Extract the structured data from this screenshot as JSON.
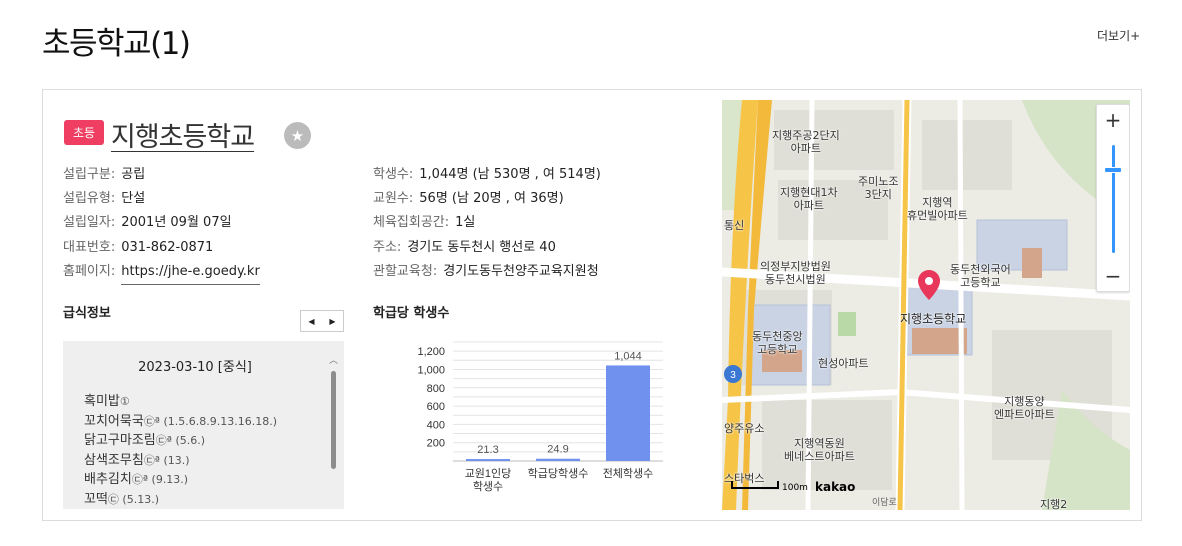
{
  "header": {
    "title": "초등학교(1)",
    "more_label": "더보기+"
  },
  "school": {
    "badge": "초등",
    "name": "지행초등학교",
    "fav_icon": "star-icon",
    "left_info": [
      {
        "label": "설립구분",
        "value": "공립"
      },
      {
        "label": "설립유형",
        "value": "단설"
      },
      {
        "label": "설립일자",
        "value": "2001년 09월 07일"
      },
      {
        "label": "대표번호",
        "value": "031-862-0871"
      },
      {
        "label": "홈페이지",
        "value": "https://jhe-e.goedy.kr"
      }
    ],
    "right_info": [
      {
        "label": "학생수",
        "value": "1,044명 (남 530명 , 여 514명)"
      },
      {
        "label": "교원수",
        "value": "56명 (남 20명 , 여 36명)"
      },
      {
        "label": "체육집회공간",
        "value": "1실"
      },
      {
        "label": "주소",
        "value": "경기도 동두천시 행선로 40"
      },
      {
        "label": "관할교육청",
        "value": "경기도동두천양주교육지원청"
      }
    ]
  },
  "meal": {
    "title": "급식정보",
    "prev_icon": "triangle-left-icon",
    "next_icon": "triangle-right-icon",
    "date": "2023-03-10 [중식]",
    "items": [
      {
        "name": "혹미밥",
        "allergy": "①"
      },
      {
        "name": "꼬치어묵국",
        "allergy": "㉢ª (1.5.6.8.9.13.16.18.)"
      },
      {
        "name": "닭고구마조림",
        "allergy": "㉢ª (5.6.)"
      },
      {
        "name": "삼색조무침",
        "allergy": "㉢ª (13.)"
      },
      {
        "name": "배추김치",
        "allergy": "㉢ª (9.13.)"
      },
      {
        "name": "꼬떡",
        "allergy": "㉢ (5.13.)"
      }
    ]
  },
  "chart_title": "학급당 학생수",
  "chart_data": {
    "type": "bar",
    "categories": [
      "교원1인당\n학생수",
      "학급당학생수",
      "전체학생수"
    ],
    "values": [
      21.3,
      24.9,
      1044
    ],
    "value_labels": [
      "21.3",
      "24.9",
      "1,044"
    ],
    "y_ticks": [
      "200",
      "400",
      "600",
      "800",
      "1,000",
      "1,200"
    ],
    "ylim": [
      0,
      1300
    ],
    "grid": true,
    "color": "#7092ee"
  },
  "map": {
    "labels": [
      "지행주공2단지\n아파트",
      "지행현대1차\n아파트",
      "주미노조\n3단지",
      "지행역\n휴먼빌아파트",
      "동두천외국어\n고등학교",
      "의정부지방법원\n동두천시법원",
      "지행초등학교",
      "동두천중앙\n고등학교",
      "현성아파트",
      "지행동양\n엔파트아파트",
      "지행역동원\n베네스트아파트",
      "양주유소",
      "통신",
      "스타벅스",
      "지행2"
    ],
    "zoom_in": "+",
    "zoom_out": "−",
    "scale": "100m",
    "brand": "kakao",
    "route_number": "3",
    "road_label": "이담로",
    "road_color": "#f6c447",
    "marker_color": "#e8375b"
  }
}
